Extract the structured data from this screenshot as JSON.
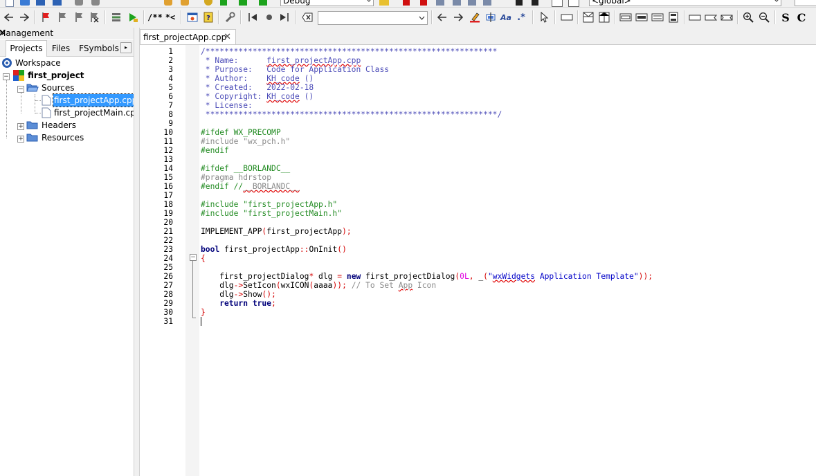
{
  "toolbar_top": {
    "build_target": "Debug",
    "scope": "<global>"
  },
  "toolbar": {
    "comment_label": "/**",
    "stream_comment_label": "*<",
    "search_value": "",
    "regex_label": ".*",
    "aa_label": "Aa",
    "s_label": "S",
    "c_label": "C"
  },
  "management": {
    "title": "Management",
    "close": "✕",
    "tabs": [
      "Projects",
      "Files",
      "FSymbols"
    ],
    "scroll_arrow": "▸"
  },
  "tree": {
    "workspace": "Workspace",
    "project": "first_project",
    "sources": "Sources",
    "files": [
      "first_projectApp.cpp",
      "first_projectMain.cpp"
    ],
    "headers": "Headers",
    "resources": "Resources"
  },
  "editor": {
    "tab_label": "first_projectApp.cpp",
    "tab_close": "✕",
    "line_numbers": [
      "1",
      "2",
      "3",
      "4",
      "5",
      "6",
      "7",
      "8",
      "9",
      "10",
      "11",
      "12",
      "13",
      "14",
      "15",
      "16",
      "17",
      "18",
      "19",
      "20",
      "21",
      "22",
      "23",
      "24",
      "25",
      "26",
      "27",
      "28",
      "29",
      "30",
      "31"
    ],
    "lines": {
      "l1": "/**************************************************************",
      "l2_a": " * Name:      ",
      "l2_b": "first_projectApp.cpp",
      "l3": " * Purpose:   Code for Application Class",
      "l4_a": " * Author:    ",
      "l4_b": "KH_code",
      "l4_c": " ()",
      "l5": " * Created:   2022-02-18",
      "l6_a": " * Copyright: ",
      "l6_b": "KH_code",
      "l6_c": " ()",
      "l7": " * License:",
      "l8": " **************************************************************/",
      "l10": "#ifdef WX_PRECOMP",
      "l11": "#include \"wx_pch.h\"",
      "l12": "#endif",
      "l14": "#ifdef __BORLANDC__",
      "l15": "#pragma hdrstop",
      "l16_a": "#endif //",
      "l16_b": "__BORLANDC__",
      "l18": "#include \"first_projectApp.h\"",
      "l19": "#include \"first_projectMain.h\"",
      "l21_a": "IMPLEMENT_APP",
      "l21_b": "(",
      "l21_c": "first_projectApp",
      "l21_d": ");",
      "l23_a": "bool",
      "l23_b": " first_projectApp",
      "l23_c": "::",
      "l23_d": "OnInit",
      "l23_e": "()",
      "l24": "{",
      "l26_a": "    first_projectDialog",
      "l26_b": "*",
      "l26_c": " dlg ",
      "l26_d": "=",
      "l26_e": " ",
      "l26_f": "new",
      "l26_g": " first_projectDialog",
      "l26_h": "(",
      "l26_i": "0L",
      "l26_j": ", ",
      "l26_k": "_",
      "l26_l": "(",
      "l26_m": "\"",
      "l26_n": "wxWidgets",
      "l26_o": " Application Template\"",
      "l26_p": "));",
      "l27_a": "    dlg",
      "l27_b": "->",
      "l27_c": "SetIcon",
      "l27_d": "(",
      "l27_e": "wxICON",
      "l27_f": "(",
      "l27_g": "aaaa",
      "l27_h": "));",
      "l27_i": " // To Set ",
      "l27_j": "App",
      "l27_k": " Icon",
      "l28_a": "    dlg",
      "l28_b": "->",
      "l28_c": "Show",
      "l28_d": "();",
      "l29_a": "    return",
      "l29_b": " true",
      "l29_c": ";",
      "l30": "}"
    }
  }
}
